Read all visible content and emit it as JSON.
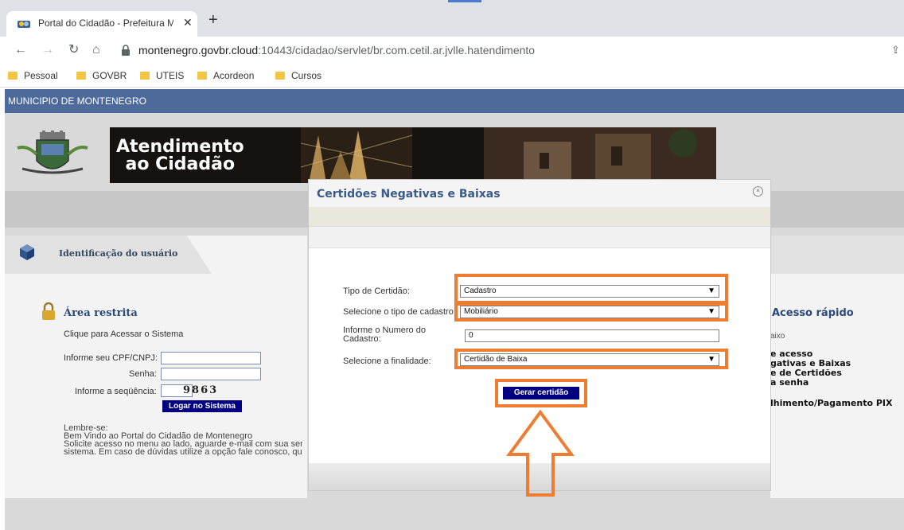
{
  "browser": {
    "tab_title": "Portal do Cidadão - Prefeitura M",
    "tab_close": "✕",
    "new_tab": "+",
    "url_host": "montenegro.govbr.cloud",
    "url_rest": ":10443/cidadao/servlet/br.com.cetil.ar.jvlle.hatendimento",
    "bookmarks": [
      "Pessoal",
      "GOVBR",
      "UTEIS",
      "Acordeon",
      "Cursos"
    ]
  },
  "header": {
    "municipality": "MUNICIPIO DE MONTENEGRO",
    "banner_line1": "Atendimento",
    "banner_line2": "ao Cidadão"
  },
  "left_panel": {
    "section_title": "Identificação do usuário",
    "area_title": "Área restrita",
    "click_text": "Clique para Acessar o Sistema",
    "cpf_label": "Informe seu CPF/CNPJ:",
    "password_label": "Senha:",
    "sequence_label": "Informe a seqüência:",
    "sequence_code": "9863",
    "login_button": "Logar no Sistema",
    "remember_title": "Lembre-se:",
    "remember_line1": "Bem Vindo ao Portal do Cidadão de Montenegro",
    "remember_line2": "Solicite acesso no menu ao lado, aguarde e-mail com sua senha",
    "remember_line3": "sistema. Em caso de dúvidas utilize a opção fale conosco, que e"
  },
  "right_panel": {
    "title": "Acesso rápido",
    "subtitle": "aixo",
    "links": [
      "e acesso",
      "gativas e Baixas",
      "e de Certidões",
      "a senha",
      "lhimento/Pagamento PIX"
    ]
  },
  "modal": {
    "title": "Certidões Negativas e Baixas",
    "close_glyph": "×",
    "tipo_label": "Tipo de Certidão:",
    "tipo_value": "Cadastro",
    "cadastro_label": "Selecione o tipo de cadastro:",
    "cadastro_value": "Mobiliário",
    "numero_label_1": "Informe o Numero do",
    "numero_label_2": "Cadastro:",
    "numero_value": "0",
    "finalidade_label": "Selecione a finalidade:",
    "finalidade_value": "Certidão de Baixa",
    "submit_button": "Gerar certidão",
    "chevron": "⌄"
  },
  "colors": {
    "muni_bar": "#4d6a9b",
    "button_navy": "#000080",
    "highlight_orange": "#ed7d31",
    "title_blue": "#3c5a86"
  },
  "icons": [
    "favicon-icon",
    "close-icon",
    "back-icon",
    "forward-icon",
    "reload-icon",
    "home-icon",
    "lock-icon",
    "share-icon",
    "folder-icon",
    "cube-icon",
    "padlock-icon",
    "modal-close-icon",
    "chevron-down-icon",
    "arrow-up-icon"
  ]
}
